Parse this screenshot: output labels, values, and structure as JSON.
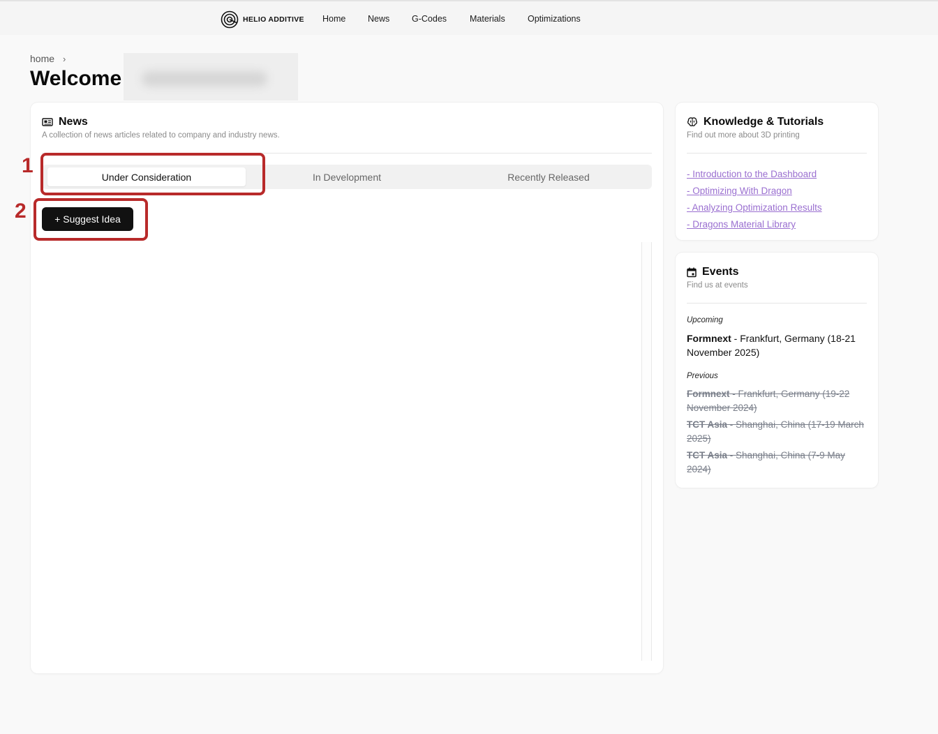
{
  "header": {
    "brand": "HELIO ADDITIVE",
    "nav": [
      "Home",
      "News",
      "G-Codes",
      "Materials",
      "Optimizations"
    ]
  },
  "breadcrumb": {
    "home": "home",
    "separator": "›"
  },
  "page": {
    "title": "Welcome"
  },
  "news": {
    "title": "News",
    "subtitle": "A collection of news articles related to company and industry news.",
    "tabs": [
      "Under Consideration",
      "In Development",
      "Recently Released"
    ],
    "active_tab": "Under Consideration",
    "suggest_button": "+ Suggest Idea"
  },
  "knowledge": {
    "title": "Knowledge & Tutorials",
    "subtitle": "Find out more about 3D printing",
    "links": [
      "- Introduction to the Dashboard",
      "- Optimizing With Dragon",
      "- Analyzing Optimization Results",
      "- Dragons Material Library"
    ]
  },
  "events": {
    "title": "Events",
    "subtitle": "Find us at events",
    "upcoming_label": "Upcoming",
    "upcoming": [
      {
        "name": "Formnext",
        "details": " - Frankfurt, Germany (18-21 November 2025)"
      }
    ],
    "previous_label": "Previous",
    "previous": [
      {
        "name": "Formnext",
        "details": " - Frankfurt, Germany (19-22 November 2024)"
      },
      {
        "name": "TCT Asia",
        "details": " - Shanghai, China (17-19 March 2025)"
      },
      {
        "name": "TCT Asia",
        "details": " - Shanghai, China (7-9 May 2024)"
      }
    ]
  },
  "annotations": [
    "1",
    "2"
  ],
  "colors": {
    "accent_link": "#9a6fd0",
    "annotation": "#b82a2a",
    "button_bg": "#111111"
  }
}
